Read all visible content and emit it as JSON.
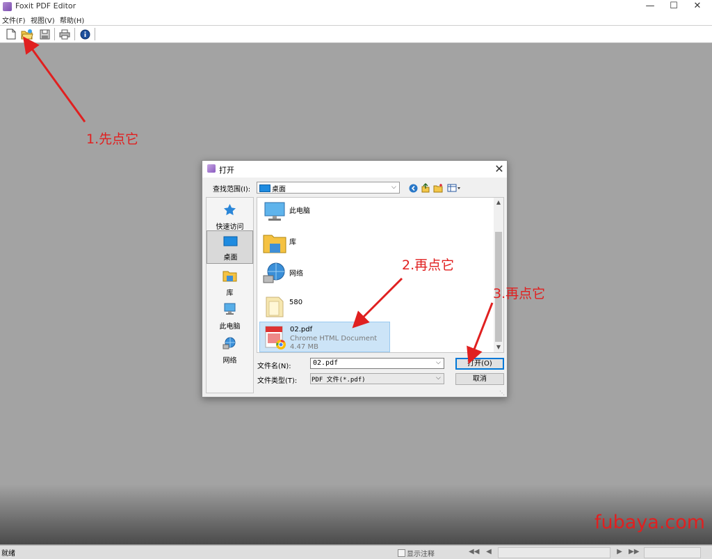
{
  "app": {
    "title": "Foxit PDF Editor",
    "window_controls": {
      "minimize": "—",
      "maximize": "☐",
      "close": "✕"
    }
  },
  "menu": [
    "文件(F)",
    "视图(V)",
    "帮助(H)"
  ],
  "toolbar": [
    "new-document",
    "open-file",
    "save",
    "print",
    "about-info"
  ],
  "annotations": {
    "step1": "1.先点它",
    "step2": "2.再点它",
    "step3": "3.再点它",
    "watermark": "fubaya.com",
    "arrow_color": "#e02020"
  },
  "dialog": {
    "title": "打开",
    "close": "✕",
    "look_in_label": "查找范围(I):",
    "look_in_value": "桌面",
    "places": [
      {
        "label": "快速访问",
        "icon": "star-icon"
      },
      {
        "label": "桌面",
        "icon": "desktop-icon",
        "selected": true
      },
      {
        "label": "库",
        "icon": "library-icon"
      },
      {
        "label": "此电脑",
        "icon": "computer-icon"
      },
      {
        "label": "网络",
        "icon": "network-icon"
      }
    ],
    "files": [
      {
        "name": "此电脑",
        "icon": "computer-icon"
      },
      {
        "name": "库",
        "icon": "library-folder-icon"
      },
      {
        "name": "网络",
        "icon": "network-icon"
      },
      {
        "name": "580",
        "icon": "folder-icon"
      },
      {
        "name": "02.pdf",
        "type": "Chrome HTML Document",
        "size": "4.47 MB",
        "icon": "pdf-file-icon",
        "selected": true
      }
    ],
    "filename_label": "文件名(N):",
    "filename_value": "02.pdf",
    "filetype_label": "文件类型(T):",
    "filetype_value": "PDF 文件(*.pdf)",
    "open_button": "打开(O)",
    "cancel_button": "取消"
  },
  "status": {
    "text": "就绪",
    "show_annotations": "显示注释",
    "show_annotations_checked": false
  },
  "colors": {
    "accent": "#0078d7",
    "selection": "#cce4f7",
    "workspace": "#a3a3a3"
  }
}
